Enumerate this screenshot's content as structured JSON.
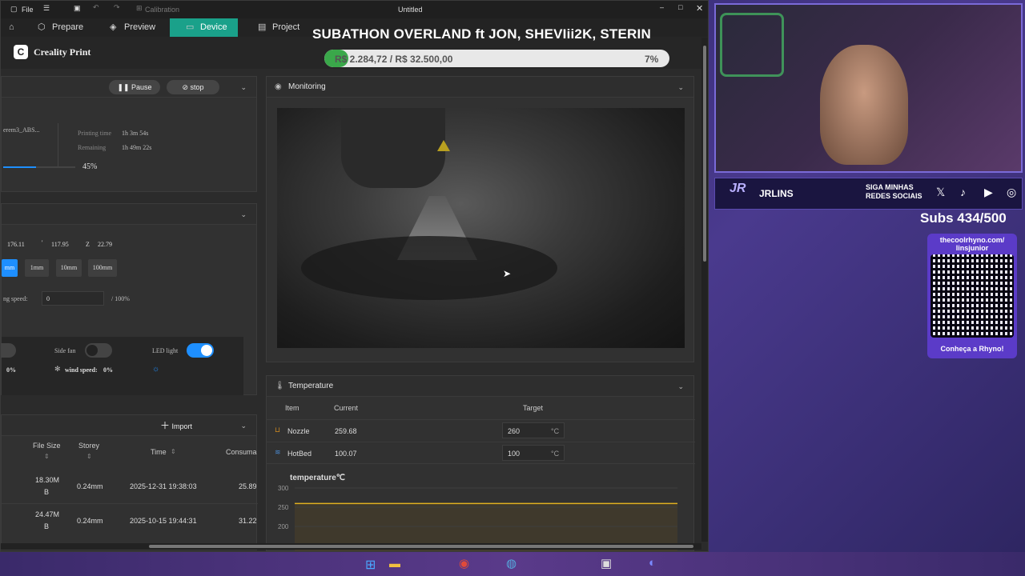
{
  "titlebar": {
    "file": "File",
    "calibration": "Calibration",
    "title": "Untitled"
  },
  "nav": {
    "prepare": "Prepare",
    "preview": "Preview",
    "device": "Device",
    "project": "Project"
  },
  "brand": "Creality Print",
  "overlay": {
    "subathon": "SUBATHON OVERLAND ft JON, SHEVIii2K, STERIN",
    "goal": "R$ 2.284,72 / R$ 32.500,00",
    "goal_pct": "7%",
    "goal_fraction": 0.07,
    "social_title": "SIGA MINHAS REDES SOCIAIS",
    "logo": "JRLINS",
    "subs": "Subs 434/500",
    "link_line1": "thecoolrhyno.com/",
    "link_line2": "linsjunior",
    "qr_caption": "Conheça a Rhyno!"
  },
  "print_panel": {
    "pause": "Pause",
    "stop": "stop",
    "file_name": "erem3_ABS...",
    "printing_time_label": "Printing time",
    "printing_time": "1h 3m 54s",
    "remaining_label": "Remaining",
    "remaining": "1h 49m 22s",
    "progress": "45%",
    "progress_fraction": 0.45
  },
  "control_panel": {
    "x": "176.11",
    "y_label": "'",
    "y": "117.95",
    "z_label": "Z",
    "z": "22.79",
    "steps": [
      "mm",
      "1mm",
      "10mm",
      "100mm"
    ],
    "speed_label": "ng speed:",
    "speed_value": "0",
    "speed_max": "/ 100%",
    "side_fan": "Side fan",
    "led_light": "LED light",
    "fan_pct": "0%",
    "wind_speed_label": "wind speed:",
    "wind_speed": "0%"
  },
  "files_panel": {
    "import": "Import",
    "headers": [
      "File Size",
      "Storey",
      "Time",
      "Consuma"
    ],
    "rows": [
      {
        "size1": "18.30M",
        "size2": "B",
        "storey": "0.24mm",
        "time": "2025-12-31 19:38:03",
        "cons": "25.89"
      },
      {
        "size1": "24.47M",
        "size2": "B",
        "storey": "0.24mm",
        "time": "2025-10-15 19:44:31",
        "cons": "31.22"
      }
    ]
  },
  "monitoring": {
    "title": "Monitoring"
  },
  "temperature": {
    "title": "Temperature",
    "col_item": "Item",
    "col_current": "Current",
    "col_target": "Target",
    "rows": [
      {
        "name": "Nozzle",
        "current": "259.68",
        "target": "260",
        "unit": "°C"
      },
      {
        "name": "HotBed",
        "current": "100.07",
        "target": "100",
        "unit": "°C"
      }
    ],
    "chart_title": "temperature℃",
    "ticks": [
      "300",
      "250",
      "200"
    ]
  },
  "chart_data": {
    "type": "line",
    "title": "temperature℃",
    "xlabel": "",
    "ylabel": "",
    "ylim": [
      200,
      300
    ],
    "series": [
      {
        "values": [
          259.7,
          259.7,
          259.7,
          259.7,
          259.7,
          259.7,
          259.7,
          259.7
        ]
      }
    ]
  },
  "colors": {
    "accent": "#1aa18a",
    "toggle": "#1e8fff",
    "goal_bar": "#3aa84a",
    "chart_line": "#e0b020"
  }
}
